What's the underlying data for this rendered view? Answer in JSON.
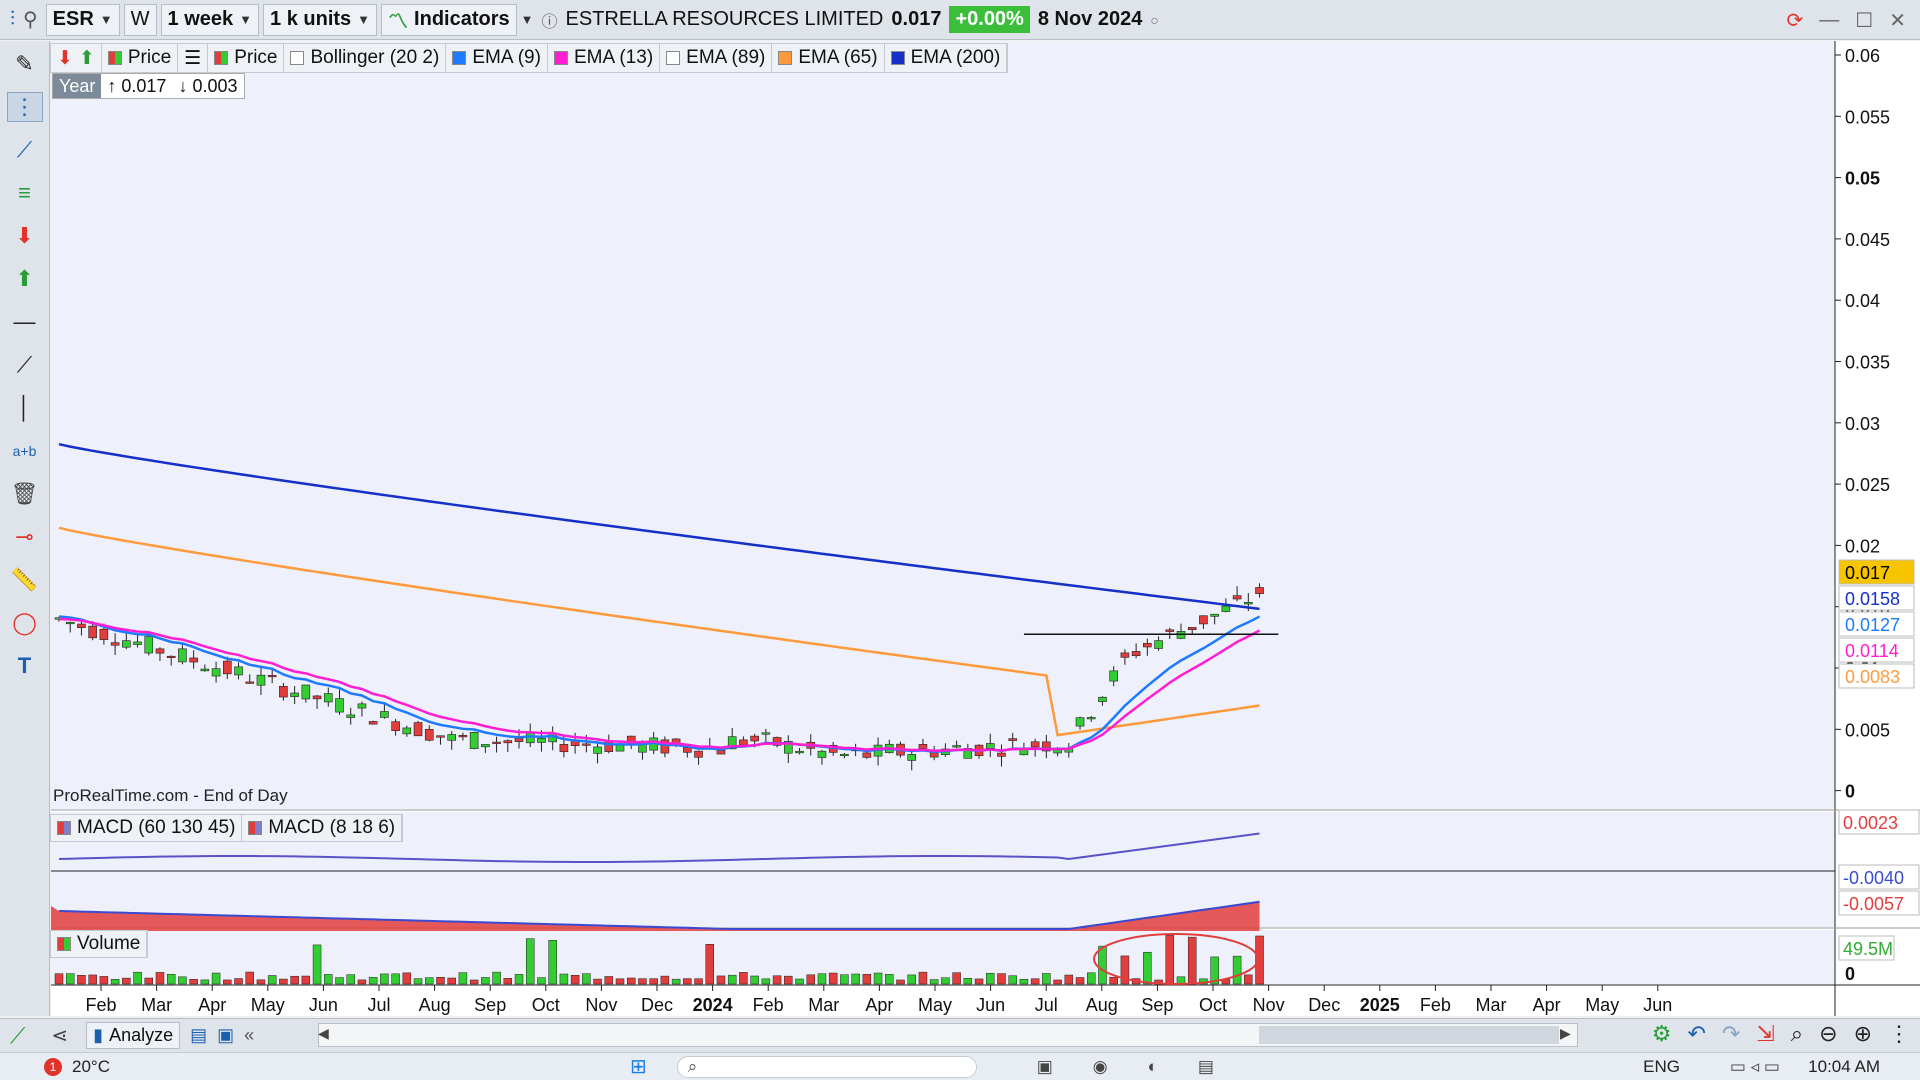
{
  "toolbar": {
    "ticker": "ESR",
    "w_label": "W",
    "period": "1 week",
    "units": "1 k units",
    "indicators": "Indicators",
    "company": "ESTRELLA RESOURCES LIMITED",
    "last_price": "0.017",
    "change": "+0.00%",
    "date": "8 Nov 2024"
  },
  "legend": {
    "price1": "Price",
    "price2": "Price",
    "bollinger": "Bollinger (20 2)",
    "ema9": "EMA (9)",
    "ema13": "EMA (13)",
    "ema89": "EMA (89)",
    "ema65": "EMA (65)",
    "ema200": "EMA (200)"
  },
  "yearbox": {
    "label": "Year",
    "high": "0.017",
    "low": "0.003"
  },
  "watermark": "ProRealTime.com - End of Day",
  "macd_legend": {
    "m1": "MACD (60 130 45)",
    "m2": "MACD (8 18 6)"
  },
  "volume_legend": "Volume",
  "analyze_label": "Analyze",
  "colors": {
    "up": "#33cc33",
    "down": "#e23d3d",
    "ema9": "#1e7bff",
    "ema13": "#ff1ed2",
    "ema65": "#ff9a3c",
    "ema200": "#1530c8",
    "grid_bg": "#eef0fb"
  },
  "chart_data": {
    "type": "candlestick",
    "title": "ESTRELLA RESOURCES LIMITED",
    "ylim": [
      0,
      0.06
    ],
    "y_ticks": [
      "0.06",
      "0.055",
      "0.05",
      "0.045",
      "0.04",
      "0.035",
      "0.03",
      "0.025",
      "0.02",
      "0.015",
      "0.01",
      "0.005",
      "0"
    ],
    "x_ticks": [
      "Feb",
      "Mar",
      "Apr",
      "May",
      "Jun",
      "Jul",
      "Aug",
      "Sep",
      "Oct",
      "Nov",
      "Dec",
      "2024",
      "Feb",
      "Mar",
      "Apr",
      "May",
      "Jun",
      "Jul",
      "Aug",
      "Sep",
      "Oct",
      "Nov",
      "Dec",
      "2025",
      "Feb",
      "Mar",
      "Apr",
      "May",
      "Jun"
    ],
    "price_labels": [
      {
        "value": "0.017",
        "color": "#f7c400",
        "text_color": "#000"
      },
      {
        "value": "0.0158",
        "color": "#ffffff",
        "text_color": "#1530c8"
      },
      {
        "value": "0.0127",
        "color": "#ffffff",
        "text_color": "#1e7bff"
      },
      {
        "value": "0.0114",
        "color": "#ffffff",
        "text_color": "#ff1ed2"
      },
      {
        "value": "0.0083",
        "color": "#ffffff",
        "text_color": "#ff9a3c"
      }
    ],
    "resistance_level": 0.0138,
    "series": [
      {
        "name": "EMA (200)",
        "start": 0.0288,
        "end": 0.0158
      },
      {
        "name": "EMA (65)",
        "start": 0.0222,
        "end": 0.0083
      },
      {
        "name": "EMA (9)",
        "start": 0.0152,
        "end": 0.0127
      },
      {
        "name": "EMA (13)",
        "start": 0.015,
        "end": 0.0114
      }
    ],
    "macd_labels": [
      "0.0023",
      "-0.0040",
      "-0.0057"
    ],
    "volume_label": "49.5M",
    "volume_zero": "0"
  },
  "taskbar": {
    "temp": "20°C",
    "lang": "ENG",
    "time": "10:04 AM"
  }
}
